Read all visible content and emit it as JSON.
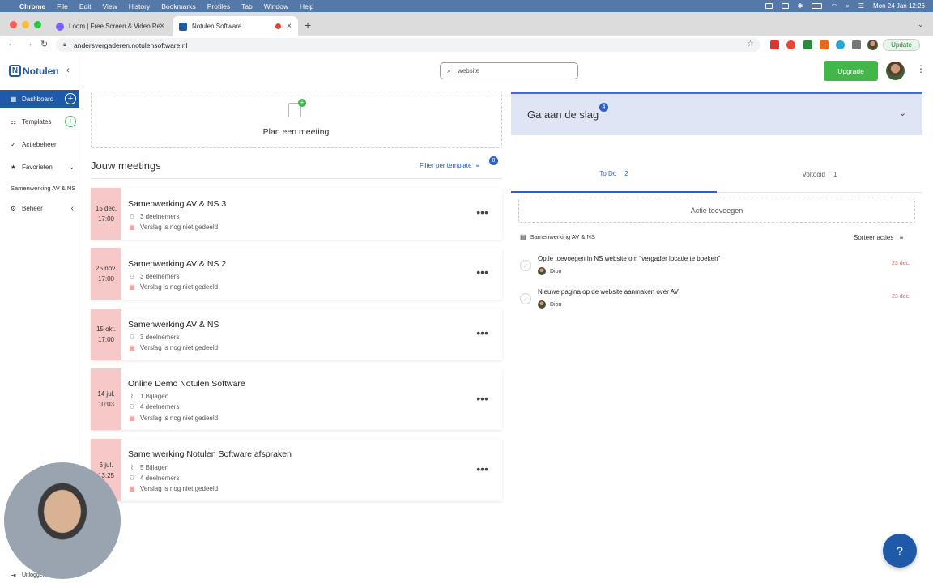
{
  "menubar": {
    "app": "Chrome",
    "items": [
      "File",
      "Edit",
      "View",
      "History",
      "Bookmarks",
      "Profiles",
      "Tab",
      "Window",
      "Help"
    ],
    "clock": "Mon 24 Jan  12:26"
  },
  "browser": {
    "tabs": [
      {
        "label": "Loom | Free Screen & Video Re"
      },
      {
        "label": "Notulen Software"
      }
    ],
    "url": "andersvergaderen.notulensoftware.nl",
    "update_label": "Update"
  },
  "sidebar": {
    "brand": "Notulen",
    "items": [
      {
        "label": "Dashboard"
      },
      {
        "label": "Templates"
      },
      {
        "label": "Actiebeheer"
      },
      {
        "label": "Favorieten"
      },
      {
        "label": "Samenwerking AV & NS"
      },
      {
        "label": "Beheer"
      }
    ],
    "logout_label": "Uitloggen"
  },
  "header": {
    "search_value": "website",
    "upgrade_label": "Upgrade"
  },
  "plan": {
    "label": "Plan een meeting"
  },
  "meetings": {
    "title": "Jouw meetings",
    "filter_label": "Filter per template",
    "filter_count": "0",
    "items": [
      {
        "date_top": "15 dec.",
        "date_bottom": "17:00",
        "title": "Samenwerking AV & NS 3",
        "attachments": "",
        "participants": "3 deelnemers",
        "status": "Verslag is nog niet gedeeld"
      },
      {
        "date_top": "25 nov.",
        "date_bottom": "17:00",
        "title": "Samenwerking AV & NS 2",
        "attachments": "",
        "participants": "3 deelnemers",
        "status": "Verslag is nog niet gedeeld"
      },
      {
        "date_top": "15 okt.",
        "date_bottom": "17:00",
        "title": "Samenwerking AV & NS",
        "attachments": "",
        "participants": "3 deelnemers",
        "status": "Verslag is nog niet gedeeld"
      },
      {
        "date_top": "14 jul.",
        "date_bottom": "10:03",
        "title": "Online Demo Notulen Software",
        "attachments": "1 Bijlagen",
        "participants": "4 deelnemers",
        "status": "Verslag is nog niet gedeeld"
      },
      {
        "date_top": "6 jul.",
        "date_bottom": "13:25",
        "title": "Samenwerking Notulen Software afspraken",
        "attachments": "5 Bijlagen",
        "participants": "4 deelnemers",
        "status": "Verslag is nog niet gedeeld"
      }
    ]
  },
  "getting_started": {
    "title": "Ga aan de slag",
    "badge": "4"
  },
  "actions": {
    "tabs": [
      {
        "label": "To Do",
        "count": "2"
      },
      {
        "label": "Voltooid",
        "count": "1"
      }
    ],
    "add_label": "Actie toevoegen",
    "group_label": "Samenwerking AV & NS",
    "sort_label": "Sorteer acties",
    "items": [
      {
        "title": "Optie toevoegen in NS website om \"vergader locatie te boeken\"",
        "user": "Dion",
        "due": "23 dec."
      },
      {
        "title": "Nieuwe pagina op de website aanmaken over AV",
        "user": "Dion",
        "due": "23 dec."
      }
    ]
  },
  "colors": {
    "brand": "#1e5aa8",
    "upgrade": "#43b64b",
    "date_block": "#f6c8c8",
    "banner": "#dfe5f5",
    "menubar": "#5479a8"
  }
}
